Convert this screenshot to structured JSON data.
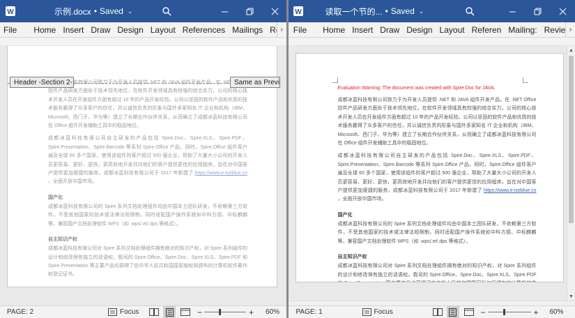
{
  "left": {
    "title": "示例.docx",
    "saved": "Saved",
    "tabs": [
      "File",
      "Home",
      "Insert",
      "Draw",
      "Design",
      "Layout",
      "References",
      "Mailings",
      "Review"
    ],
    "header_label": "Header -Section 2-",
    "same_as_previous": "Same as Previous",
    "page_indicator": "PAGE: 2",
    "focus_label": "Focus",
    "zoom_minus": "−",
    "zoom_plus": "+",
    "zoom": "60%",
    "p1": "成都冰蓝科技有限公司致力于为开发人员提供 .NET 和 JAVA 组件开发产品。在 .NET Office 控件产品研发方面处于技术领先地位，在软件开发领域具有较强的综合实力，公司的核心技术开发人员在开发组件方面有超过 10 年的产品开发经验。公司以坚固的软件产品和优质的技术服务赢得了众多客户的信任，并以诚信负责的形象与国外多家知名 IT 企业和机构（IBM、Microsoft、西门子、华为等）建立了长期合作伙伴关系，从而确立了成都冰蓝科技有限公司在 Office 组件开发辅助工具中的稳固地位。",
    "p2_before": "成都冰蓝科技有限公司自主研发的产品包括 Spire.Doc、Spire.XLS、Spire.PDF、Spire.Presentation、Spire.Barcode 等系列 Spire.Office 产品。同时，Spire.Office 组件客户遍及全球 60 多个国家，使用该组件的客户超过 500 强企业，帮助了大量大小公司的开发人员更容易、更好、更快，更高效地开发并向他们的客户提供更佳的应用程序。旨在对中国客户提供更加便捷的服务，成都冰蓝科技有限公司于 2017 年新建了",
    "p2_link": "https://www.e-iceblue.cn",
    "p2_after": "，全面开放中国市场。",
    "h1": "国产化",
    "p3": "成都冰蓝科技有限公司的 Spire 系列文档处理组件均由中国本土团队研发，不依赖第三方软件，不受其他国家的技术或法律法规限制，同时适配国产操作系统如中科方德、中标麒麟等，兼容国产文档处理软件 WPS（如 .wps/.et/.dps 等格式）。",
    "h2": "自主知识产权",
    "p4": "成都冰蓝科技有限公司对 Spire 系列文档处理组件拥有绝对的知识产权，对 Spire 系列组件的设计和修改保有独立的话语权。我司的 Spire.Office、Spire.Doc、Spire.XLS、Spire.PDF 和 Spire.Presentation 等主要产品均获得了由中华人民共和国国家版权局颁布的计算机软件著作权登记证书。"
  },
  "right": {
    "title": "读取一个节的...",
    "saved": "Saved",
    "tabs": [
      "File",
      "Home",
      "Insert",
      "Draw",
      "Design",
      "Layout",
      "Referen",
      "Mailing:",
      "Review"
    ],
    "warning": "Evaluation Warning: The document was created with Spire.Doc for JAVA.",
    "page_indicator": "PAGE: 1",
    "focus_label": "Focus",
    "zoom_minus": "−",
    "zoom_plus": "+",
    "zoom": "60%",
    "p1": "成都冰蓝科技有限公司致力于为开发人员提供 .NET 和 JAVA 组件开发产品。在 .NET Office 控件产品研发方面处于技术领先地位，在软件开发领域具有较强的综合实力，公司的核心技术开发人员在开发组件方面有超过 10 年的产品开发经验。公司以坚固的软件产品和优质的技术服务赢得了众多客户的信任，并以诚信负责的形象与国外多家知名 IT 企业和机构（IBM、Microsoft、西门子、华为等）建立了长期合作伙伴关系，从而确立了成都冰蓝科技有限公司在 Office 组件开发辅助工具中的稳固地位。",
    "p2_before": "成都冰蓝科技有限公司自主研发的产品包括 Spire.Doc、Spire.XLS、Spire.PDF、Spire.Presentation、Spire.Barcode 等系列 Spire.Office 产品。同时，Spire.Office 组件客户遍及全球 60 多个国家，使用该组件的客户超过 500 强企业，帮助了大量大小公司的开发人员更容易、更好、更快，更高效地开发并向他们的客户提供更佳的应用程序。旨在对中国客户提供更加便捷的服务，成都冰蓝科技有限公司于 2017 年新建了",
    "p2_link": "https://www.e-iceblue.cn",
    "p2_after": "，全面开放中国市场。",
    "h1": "国产化",
    "p3": "成都冰蓝科技有限公司的 Spire 系列文档处理组件均由中国本土团队研发，不依赖第三方软件，不受其他国家的技术或法律法规限制，同时适配国产操作系统如中科方德、中标麒麟等，兼容国产文档处理软件 WPS（如 .wps/.et/.dps 等格式）。",
    "h2": "自主知识产权",
    "p4": "成都冰蓝科技有限公司对 Spire 系列文档处理组件拥有绝对的知识产权，对 Spire 系列组件的设计和修改保有独立的话语权。我司的 Spire.Office、Spire.Doc、Spire.XLS、Spire.PDF 和 Spire.Presentation 等主要产品均获得了由中华人民共和国国家版权局颁布的计算机软件著作权登记证书。"
  },
  "icons": [
    "word-icon",
    "search-icon",
    "minimize-icon",
    "restore-icon",
    "close-icon",
    "focus-icon",
    "read-mode-icon",
    "print-layout-icon",
    "web-layout-icon"
  ],
  "colors": {
    "titlebar": "#2b579a",
    "warning": "#e02020",
    "link": "#2f62b8"
  }
}
